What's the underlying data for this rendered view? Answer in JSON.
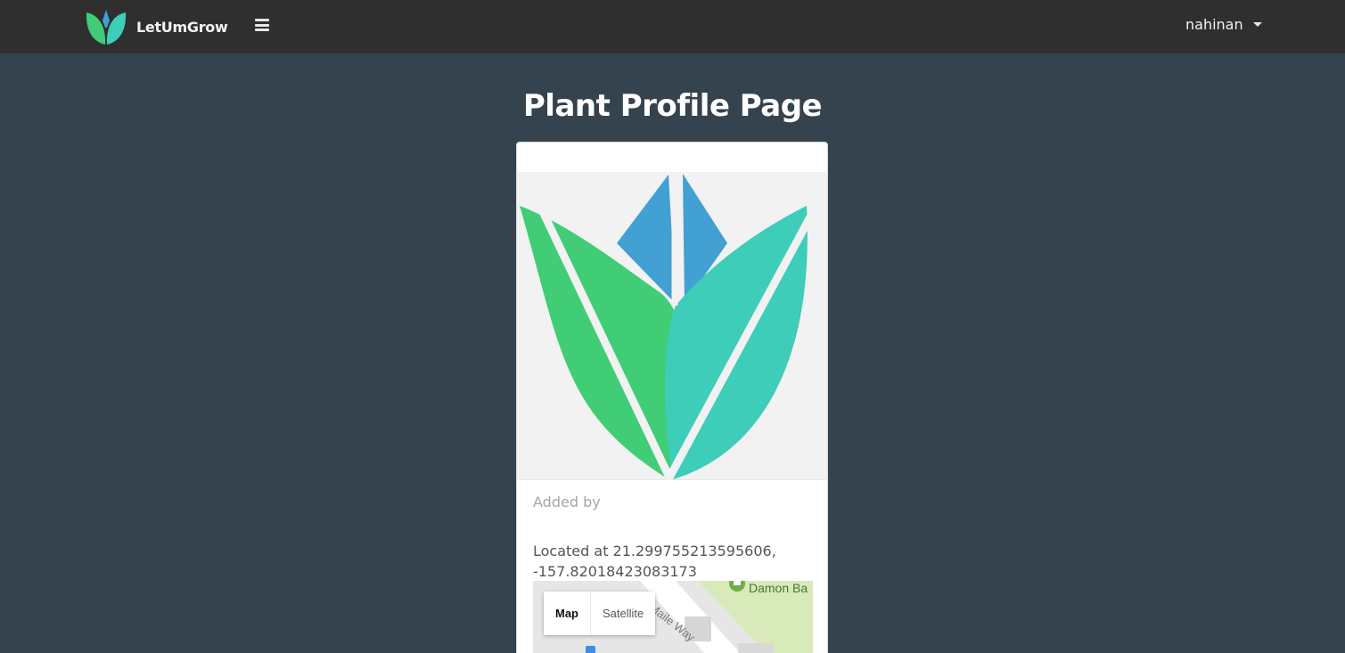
{
  "navbar": {
    "brand_name": "LetUmGrow",
    "brand_icon": "leaf-logo-icon",
    "menu_icon": "hamburger-menu-icon",
    "username": "nahinan",
    "dropdown_icon": "caret-down-icon"
  },
  "page": {
    "title": "Plant Profile Page"
  },
  "plant_card": {
    "image_icon": "leaf-logo-icon",
    "added_by_label": "Added by",
    "location_line1": "Located at 21.299755213595606,",
    "location_line2": "-157.82018423083173"
  },
  "map": {
    "type_buttons": [
      "Map",
      "Satellite"
    ],
    "selected_type": "Map",
    "labels": {
      "park": "Damon Ba",
      "road": "Maile Way"
    }
  },
  "colors": {
    "navbar_bg": "#2f2f2f",
    "page_bg": "#34434d",
    "leaf_green": "#40cd75",
    "leaf_teal": "#3ecdb8",
    "leaf_blue": "#42a0d2"
  }
}
